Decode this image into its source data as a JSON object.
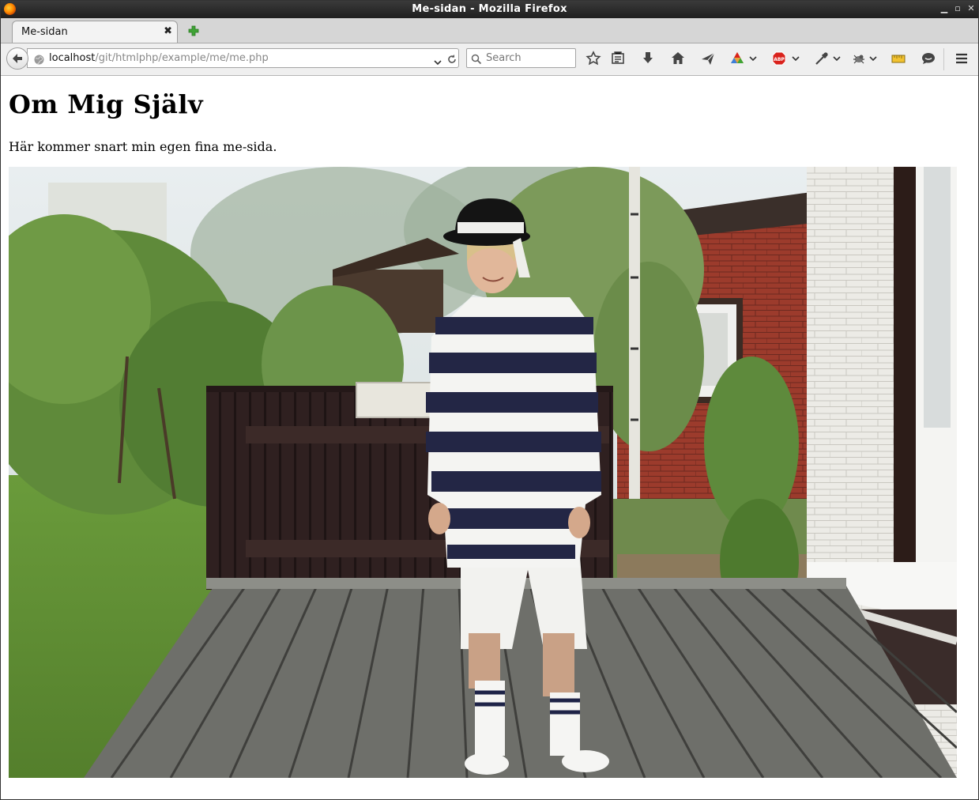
{
  "window": {
    "title": "Me-sidan - Mozilla Firefox",
    "controls": [
      "minimize-icon",
      "maximize-icon",
      "close-icon"
    ]
  },
  "tabs": [
    {
      "label": "Me-sidan",
      "active": true
    }
  ],
  "navbar": {
    "url_host": "localhost",
    "url_path": "/git/htmlphp/example/me/me.php",
    "search_placeholder": "Search",
    "toolbar_icons": [
      "bookmark-star-icon",
      "reading-list-icon",
      "downloads-icon",
      "home-icon",
      "send-icon",
      "extension-icon",
      "adblock-icon",
      "eyedropper-icon",
      "firebug-icon",
      "ruler-icon",
      "chat-icon",
      "menu-icon"
    ]
  },
  "page": {
    "heading": "Om Mig Själv",
    "intro": "Här kommer snart min egen fina me-sida.",
    "photo_subject": "person in striped costume on wooden deck"
  },
  "colors": {
    "titlebar": "#2a2a2a",
    "tabstrip": "#d6d6d6",
    "navbar": "#efefef",
    "adblock_red": "#d9221c"
  }
}
